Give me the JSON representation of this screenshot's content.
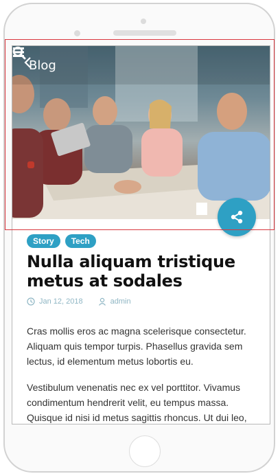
{
  "header": {
    "back_label": "Blog",
    "icons": [
      "chevron-left-icon",
      "hamburger-menu-icon",
      "search-icon"
    ]
  },
  "share": {
    "icon": "share-icon"
  },
  "post": {
    "tags": [
      "Story",
      "Tech"
    ],
    "title": "Nulla aliquam tristique metus at sodales",
    "date": "Jan 12, 2018",
    "author": "admin",
    "paragraphs": [
      "Cras mollis eros ac magna scelerisque consectetur. Aliquam quis tempor turpis. Phasellus gravida sem lectus, id elementum metus lobortis eu.",
      "Vestibulum venenatis nec ex vel porttitor. Vivamus condimentum hendrerit velit, eu tempus massa. Quisque id nisi id metus sagittis rhoncus. Ut dui leo,"
    ]
  },
  "colors": {
    "accent": "#2ea0c4",
    "meta_text": "#8fb6c4",
    "title_text": "#111111",
    "body_text": "#333333"
  }
}
